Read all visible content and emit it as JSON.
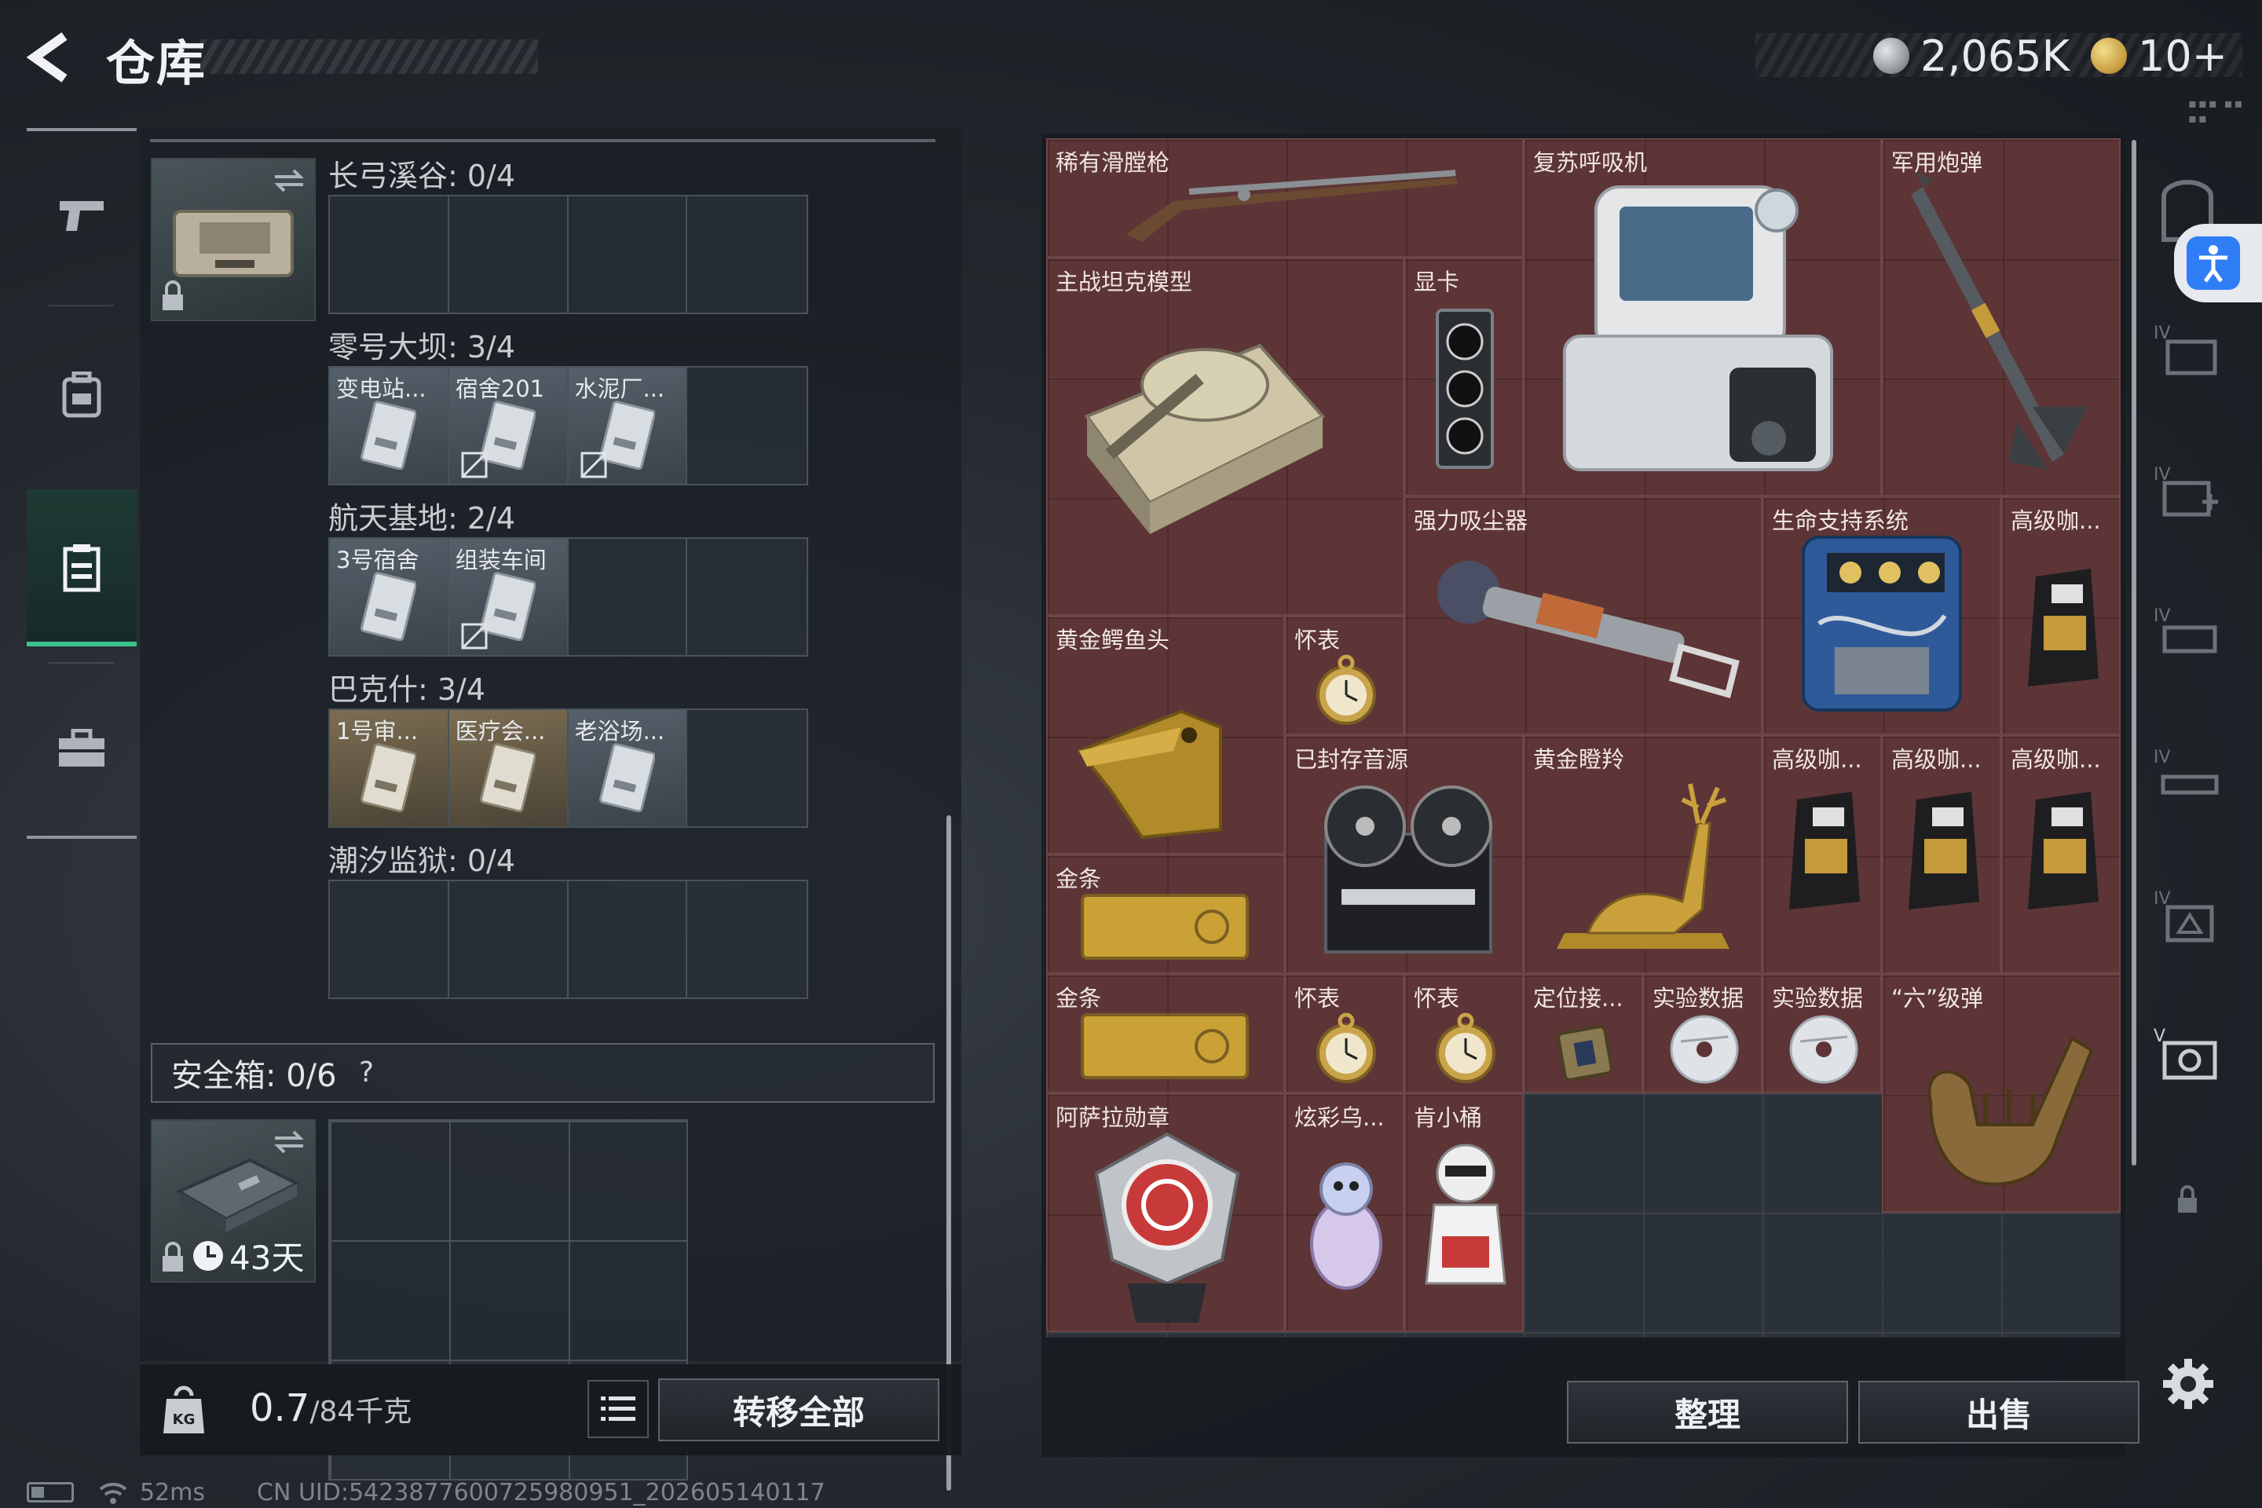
{
  "header": {
    "title": "仓库",
    "currency": {
      "money": "2,065K",
      "tokens": "10+"
    }
  },
  "left_nav": {
    "items": [
      {
        "icon": "pistol-icon"
      },
      {
        "icon": "backpack-icon"
      },
      {
        "icon": "container-icon",
        "active": true
      },
      {
        "icon": "briefcase-icon"
      }
    ]
  },
  "keycard_case": {
    "maps": [
      {
        "label": "长弓溪谷: 0/4",
        "slots": []
      },
      {
        "label": "零号大坝: 3/4",
        "slots": [
          {
            "name": "变电站..."
          },
          {
            "name": "宿舍201"
          },
          {
            "name": "水泥厂..."
          }
        ]
      },
      {
        "label": "航天基地: 2/4",
        "slots": [
          {
            "name": "3号宿舍"
          },
          {
            "name": "组装车间"
          }
        ]
      },
      {
        "label": "巴克什: 3/4",
        "slots": [
          {
            "name": "1号审..."
          },
          {
            "name": "医疗会..."
          },
          {
            "name": "老浴场..."
          }
        ]
      },
      {
        "label": "潮汐监狱: 0/4",
        "slots": []
      }
    ]
  },
  "safebox": {
    "label": "安全箱:  0/6",
    "help": "?",
    "days_left": "43天"
  },
  "weight": {
    "current": "0.7",
    "capacity": "/84千克"
  },
  "buttons": {
    "transfer_all": "转移全部",
    "sort": "整理",
    "sell": "出售"
  },
  "stash_items": [
    {
      "name": "稀有滑膛枪",
      "icon": "musket-icon"
    },
    {
      "name": "复苏呼吸机",
      "icon": "ventilator-icon"
    },
    {
      "name": "军用炮弹",
      "icon": "missile-icon"
    },
    {
      "name": "主战坦克模型",
      "icon": "tank-icon"
    },
    {
      "name": "显卡",
      "icon": "gpu-icon"
    },
    {
      "name": "强力吸尘器",
      "icon": "vacuum-icon"
    },
    {
      "name": "生命支持系统",
      "icon": "life-support-icon"
    },
    {
      "name": "高级咖...",
      "icon": "coffee-icon"
    },
    {
      "name": "黄金鳄鱼头",
      "icon": "gold-crocodile-icon"
    },
    {
      "name": "怀表",
      "icon": "pocket-watch-icon"
    },
    {
      "name": "已封存音源",
      "icon": "tape-recorder-icon"
    },
    {
      "name": "黄金瞪羚",
      "icon": "gold-gazelle-icon"
    },
    {
      "name": "高级咖...",
      "icon": "coffee-icon"
    },
    {
      "name": "高级咖...",
      "icon": "coffee-icon"
    },
    {
      "name": "高级咖...",
      "icon": "coffee-icon"
    },
    {
      "name": "金条",
      "icon": "gold-bar-icon"
    },
    {
      "name": "金条",
      "icon": "gold-bar-icon"
    },
    {
      "name": "怀表",
      "icon": "pocket-watch-icon"
    },
    {
      "name": "怀表",
      "icon": "pocket-watch-icon"
    },
    {
      "name": "定位接...",
      "icon": "locator-icon"
    },
    {
      "name": "实验数据",
      "icon": "disc-icon"
    },
    {
      "name": "实验数据",
      "icon": "disc-icon"
    },
    {
      "name": "“六”级弹",
      "icon": "hand-sculpture-icon"
    },
    {
      "name": "阿萨拉勋章",
      "icon": "medal-icon"
    },
    {
      "name": "炫彩乌...",
      "icon": "egg-figure-icon"
    },
    {
      "name": "肯小桶",
      "icon": "mascot-figure-icon"
    }
  ],
  "status_bar": {
    "ping": "52ms",
    "uid": "CN UID:5423877600725980951_202605140117"
  },
  "colors": {
    "item_bg": "#5d3536",
    "accent_green": "#3ec38e",
    "accessibility_blue": "#2f7ef5"
  }
}
